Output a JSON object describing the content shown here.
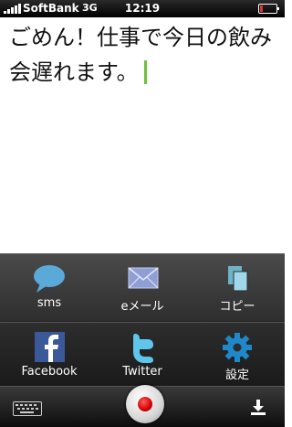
{
  "status": {
    "carrier": "SoftBank",
    "network": "3G",
    "time": "12:19"
  },
  "note": {
    "text": "ごめん！仕事で今日の飲み会遅れます。"
  },
  "share": {
    "items": [
      {
        "label": "sms",
        "icon": "sms-bubble-icon"
      },
      {
        "label": "eメール",
        "icon": "envelope-icon"
      },
      {
        "label": "コピー",
        "icon": "copy-icon"
      },
      {
        "label": "Facebook",
        "icon": "facebook-icon"
      },
      {
        "label": "Twitter",
        "icon": "twitter-icon"
      },
      {
        "label": "設定",
        "icon": "gear-icon"
      }
    ]
  },
  "toolbar": {
    "icons": [
      "keyboard-icon",
      "record-icon",
      "download-icon"
    ]
  },
  "colors": {
    "cursor": "#6fbf3a",
    "record": "#d40000",
    "sms_icon": "#5aa9d8",
    "copy_icon": "#9fd8ea"
  }
}
